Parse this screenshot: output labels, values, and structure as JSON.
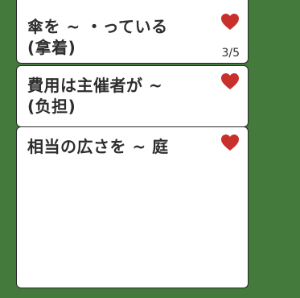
{
  "colors": {
    "background": "#447a3c",
    "card": "#ffffff",
    "heart": "#c8302b",
    "text": "#2d2d2d"
  },
  "cards": [
    {
      "lines": [
        "傘を ~ ・っている",
        "(拿着)"
      ],
      "favorite_icon": "heart-icon",
      "counter": "3/5"
    },
    {
      "lines": [
        "費用は主催者が ~",
        "(负担)"
      ],
      "favorite_icon": "heart-icon"
    },
    {
      "lines": [
        "相当の広さを ~ 庭"
      ],
      "favorite_icon": "heart-icon"
    }
  ]
}
